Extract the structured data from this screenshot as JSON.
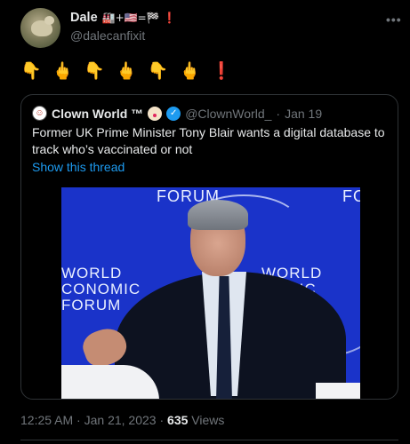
{
  "author": {
    "display_name": "Dale",
    "flags": "🏭+🇺🇸=🏁 ❗",
    "handle": "@dalecanfixit"
  },
  "more_icon": "more-dots-icon",
  "tweet_text": "👇 🖕 👇 🖕 👇 🖕",
  "tweet_text_tail": "❗",
  "quoted": {
    "display_name": "Clown World ™",
    "handle": "@ClownWorld_",
    "separator": "·",
    "date": "Jan 19",
    "text": "Former UK Prime Minister Tony Blair wants a digital database to track who’s vaccinated or not",
    "show_thread": "Show this thread",
    "media": {
      "forum_top": "FORUM",
      "forum_top_right": "FO",
      "wef_left": "WORLD\nCONOMIC\nFORUM",
      "wef_right": "WORLD\nNOMIC\nUM"
    }
  },
  "meta": {
    "time": "12:25 AM",
    "sep1": "·",
    "date": "Jan 21, 2023",
    "sep2": "·",
    "views_count": "635",
    "views_label": "Views"
  },
  "colors": {
    "background": "#000000",
    "text": "#e7e9ea",
    "muted": "#71767b",
    "link": "#1d9bf0",
    "border": "#2f3336",
    "media_bg": "#1a33c9"
  }
}
